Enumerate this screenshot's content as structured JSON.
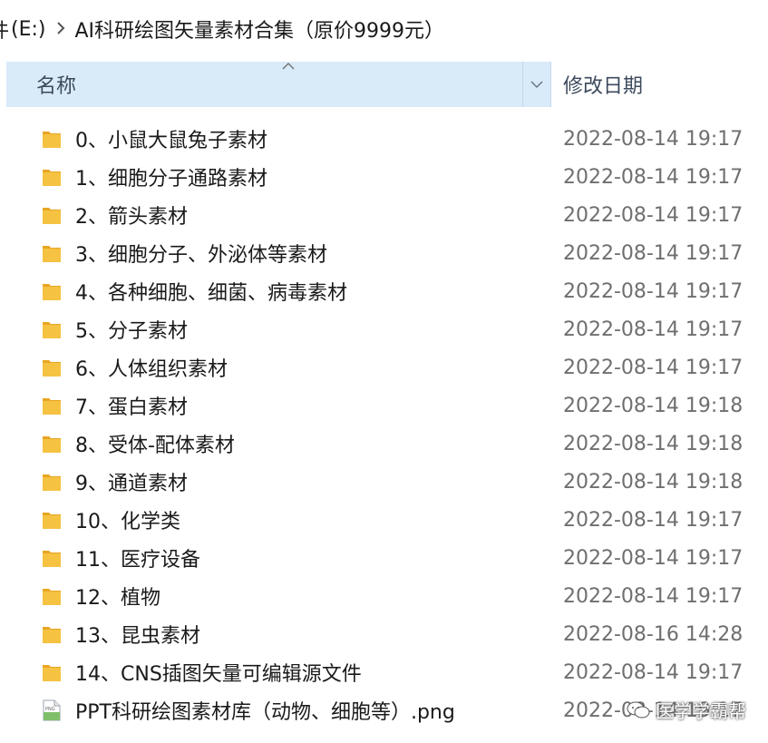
{
  "breadcrumb": {
    "partial": "件",
    "drive": "(E:)",
    "folder": "AI科研绘图矢量素材合集（原价9999元）"
  },
  "columns": {
    "name": "名称",
    "date": "修改日期"
  },
  "files": [
    {
      "name": "0、小鼠大鼠兔子素材",
      "date": "2022-08-14 19:17",
      "type": "folder"
    },
    {
      "name": "1、细胞分子通路素材",
      "date": "2022-08-14 19:17",
      "type": "folder"
    },
    {
      "name": "2、箭头素材",
      "date": "2022-08-14 19:17",
      "type": "folder"
    },
    {
      "name": "3、细胞分子、外泌体等素材",
      "date": "2022-08-14 19:17",
      "type": "folder"
    },
    {
      "name": "4、各种细胞、细菌、病毒素材",
      "date": "2022-08-14 19:17",
      "type": "folder"
    },
    {
      "name": "5、分子素材",
      "date": "2022-08-14 19:17",
      "type": "folder"
    },
    {
      "name": "6、人体组织素材",
      "date": "2022-08-14 19:17",
      "type": "folder"
    },
    {
      "name": "7、蛋白素材",
      "date": "2022-08-14 19:18",
      "type": "folder"
    },
    {
      "name": "8、受体-配体素材",
      "date": "2022-08-14 19:18",
      "type": "folder"
    },
    {
      "name": "9、通道素材",
      "date": "2022-08-14 19:18",
      "type": "folder"
    },
    {
      "name": "10、化学类",
      "date": "2022-08-14 19:17",
      "type": "folder"
    },
    {
      "name": "11、医疗设备",
      "date": "2022-08-14 19:17",
      "type": "folder"
    },
    {
      "name": "12、植物",
      "date": "2022-08-14 19:17",
      "type": "folder"
    },
    {
      "name": "13、昆虫素材",
      "date": "2022-08-16 14:28",
      "type": "folder"
    },
    {
      "name": "14、CNS插图矢量可编辑源文件",
      "date": "2022-08-14 19:17",
      "type": "folder"
    },
    {
      "name": "PPT科研绘图素材库（动物、细胞等）.png",
      "date": "2022-08-14 19:17",
      "type": "png"
    }
  ],
  "watermark": {
    "text": "医学学霸帮"
  },
  "icons": {
    "folder": "folder-icon",
    "png": "png-file-icon",
    "chevron": "chevron-right-icon",
    "dropdown": "chevron-down-icon",
    "sort": "sort-up-icon"
  },
  "colors": {
    "header_bg": "#d9eaf9",
    "folder": "#f5c242",
    "folder_dark": "#e8a623",
    "date_text": "#6f6f6f"
  }
}
